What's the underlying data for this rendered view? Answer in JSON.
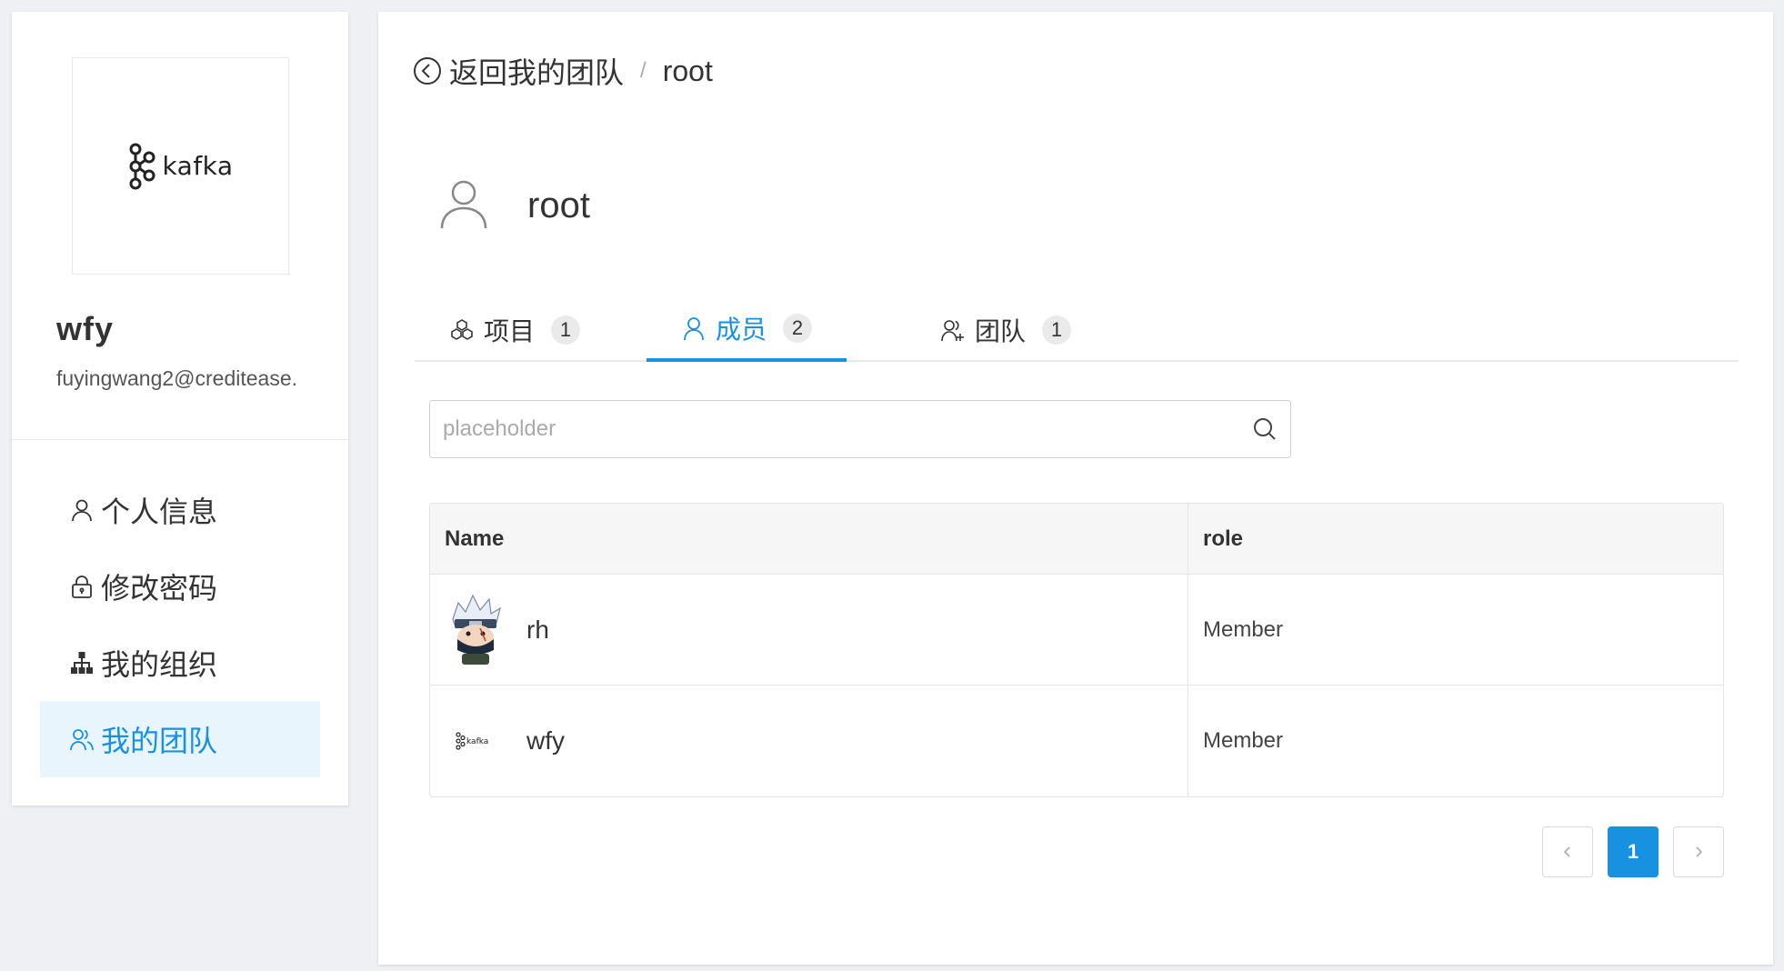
{
  "sidebar": {
    "logo_text": "kafka",
    "user_name": "wfy",
    "user_email": "fuyingwang2@creditease.",
    "menu": [
      {
        "label": "个人信息",
        "icon": "user-icon",
        "active": false
      },
      {
        "label": "修改密码",
        "icon": "lock-icon",
        "active": false
      },
      {
        "label": "我的组织",
        "icon": "org-chart-icon",
        "active": false
      },
      {
        "label": "我的团队",
        "icon": "team-icon",
        "active": true
      }
    ]
  },
  "breadcrumb": {
    "back_label": "返回我的团队",
    "separator": "/",
    "current": "root"
  },
  "profile": {
    "name": "root"
  },
  "tabs": [
    {
      "label": "项目",
      "count": "1",
      "icon": "project-icon",
      "active": false
    },
    {
      "label": "成员",
      "count": "2",
      "icon": "member-icon",
      "active": true
    },
    {
      "label": "团队",
      "count": "1",
      "icon": "team-add-icon",
      "active": false
    }
  ],
  "search": {
    "placeholder": "placeholder",
    "value": ""
  },
  "table": {
    "columns": [
      "Name",
      "role"
    ],
    "rows": [
      {
        "name": "rh",
        "role": "Member",
        "avatar": "kakashi-avatar"
      },
      {
        "name": "wfy",
        "role": "Member",
        "avatar": "kafka-logo-avatar"
      }
    ]
  },
  "pagination": {
    "prev": "<",
    "current": "1",
    "next": ">"
  },
  "colors": {
    "accent": "#1791e0",
    "active_bg": "#e9f5fd"
  }
}
